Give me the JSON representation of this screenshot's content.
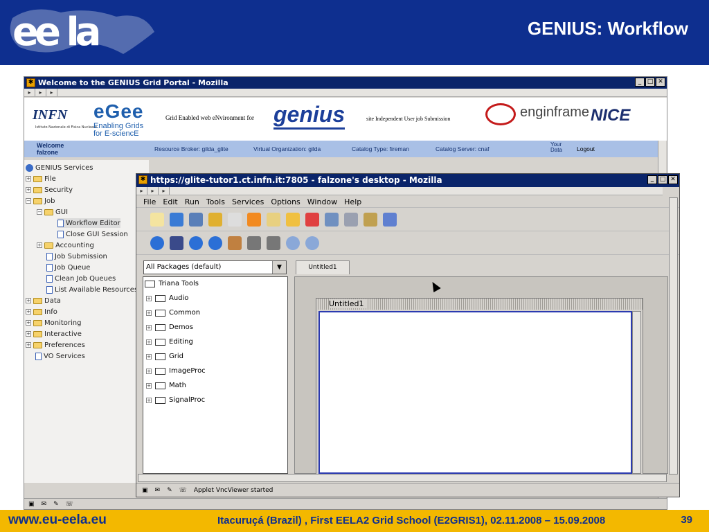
{
  "slide": {
    "title": "GENIUS: Workflow",
    "logo": "ee la",
    "footer_url": "www.eu-eela.eu",
    "footer_text": "Itacuruçá (Brazil) , First EELA2 Grid School (E2GRIS1), 02.11.2008 – 15.09.2008",
    "page_number": "39"
  },
  "outer_window": {
    "title": "Welcome to the GENIUS Grid Portal - Mozilla",
    "banner": {
      "infn": "INFN",
      "infn_sub": "Istituto Nazionale di Fisica Nucleare",
      "egee": "eGee",
      "egee_sub1": "Enabling Grids",
      "egee_sub2": "for E-sciencE",
      "grid_env": "Grid Enabled web eNvironment for",
      "genius": "genius",
      "site_ind": "site Independent User job Submission",
      "enginframe": "enginframe",
      "nice": "NICE"
    },
    "bar": {
      "welcome": "Welcome",
      "user": "falzone",
      "resource_broker": "Resource Broker: gilda_glite",
      "vo": "Virtual Organization: gilda",
      "catalog_type": "Catalog Type: fireman",
      "catalog_server": "Catalog Server: cnaf",
      "your_data_1": "Your",
      "your_data_2": "Data",
      "logout": "Logout"
    },
    "sidebar": {
      "root": "GENIUS Services",
      "items": [
        "File",
        "Security",
        "Job",
        "GUI",
        "Workflow Editor",
        "Close GUI Session",
        "Accounting",
        "Job Submission",
        "Job Queue",
        "Clean Job Queues",
        "List Available Resources",
        "Data",
        "Info",
        "Monitoring",
        "Interactive",
        "Preferences",
        "VO Services"
      ]
    }
  },
  "inner_window": {
    "title": "https://glite-tutor1.ct.infn.it:7805 - falzone's desktop - Mozilla",
    "menu": [
      "File",
      "Edit",
      "Run",
      "Tools",
      "Services",
      "Options",
      "Window",
      "Help"
    ],
    "package_select": "All Packages (default)",
    "tab": "Untitled1",
    "frame_title": "Untitled1",
    "tools_root": "Triana Tools",
    "tools": [
      "Audio",
      "Common",
      "Demos",
      "Editing",
      "Grid",
      "ImageProc",
      "Math",
      "SignalProc"
    ],
    "status": "Applet VncViewer started"
  }
}
